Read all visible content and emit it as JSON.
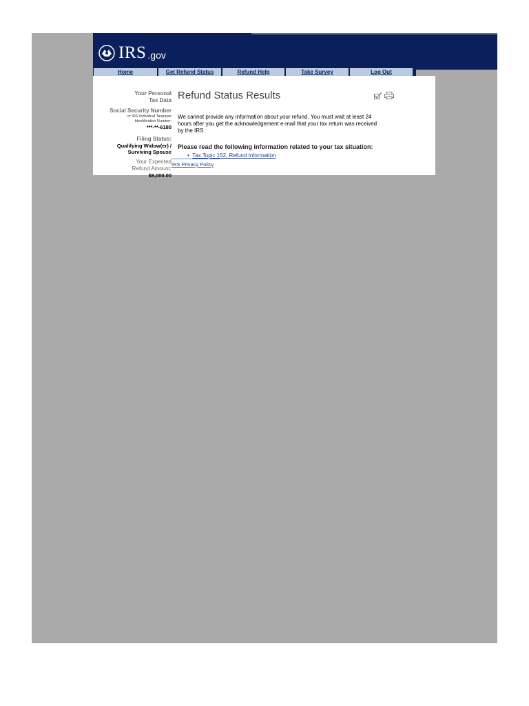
{
  "logo": {
    "text": "IRS",
    "suffix": ".gov"
  },
  "nav": [
    {
      "label": "Home"
    },
    {
      "label": "Get Refund Status"
    },
    {
      "label": "Refund Help"
    },
    {
      "label": "Take Survey"
    },
    {
      "label": "Log Out"
    }
  ],
  "sidebar": {
    "personal_title_1": "Your Personal",
    "personal_title_2": "Tax Data",
    "ssn_label": "Social Security Number",
    "ssn_sub_1": "or IRS Individual Taxpayer",
    "ssn_sub_2": "Identification Number:",
    "ssn_value": "***-**-6180",
    "filing_label": "Filing Status:",
    "filing_value_1": "Qualifying Widow(er) /",
    "filing_value_2": "Surviving Spouse",
    "refund_label_1": "Your Expected",
    "refund_label_2": "Refund Amount:",
    "refund_value": "$8,000.00"
  },
  "main": {
    "title": "Refund Status Results",
    "message_1": "We cannot provide any information about your refund. You must wait at least 24",
    "message_2": "hours after you get the acknowledgement e-mail that your tax return was received",
    "message_3": "by the IRS",
    "info_heading": "Please read the following information related to your tax situation:",
    "link": "Tax Topic 152, Refund Information",
    "privacy": "IRS Privacy Policy"
  },
  "colors": {
    "header": "#0b1f5c",
    "tab": "#b9cbe4",
    "viewport": "#aaaaaa"
  },
  "icons": [
    "seal-icon",
    "checkmark-icon",
    "print-icon"
  ]
}
